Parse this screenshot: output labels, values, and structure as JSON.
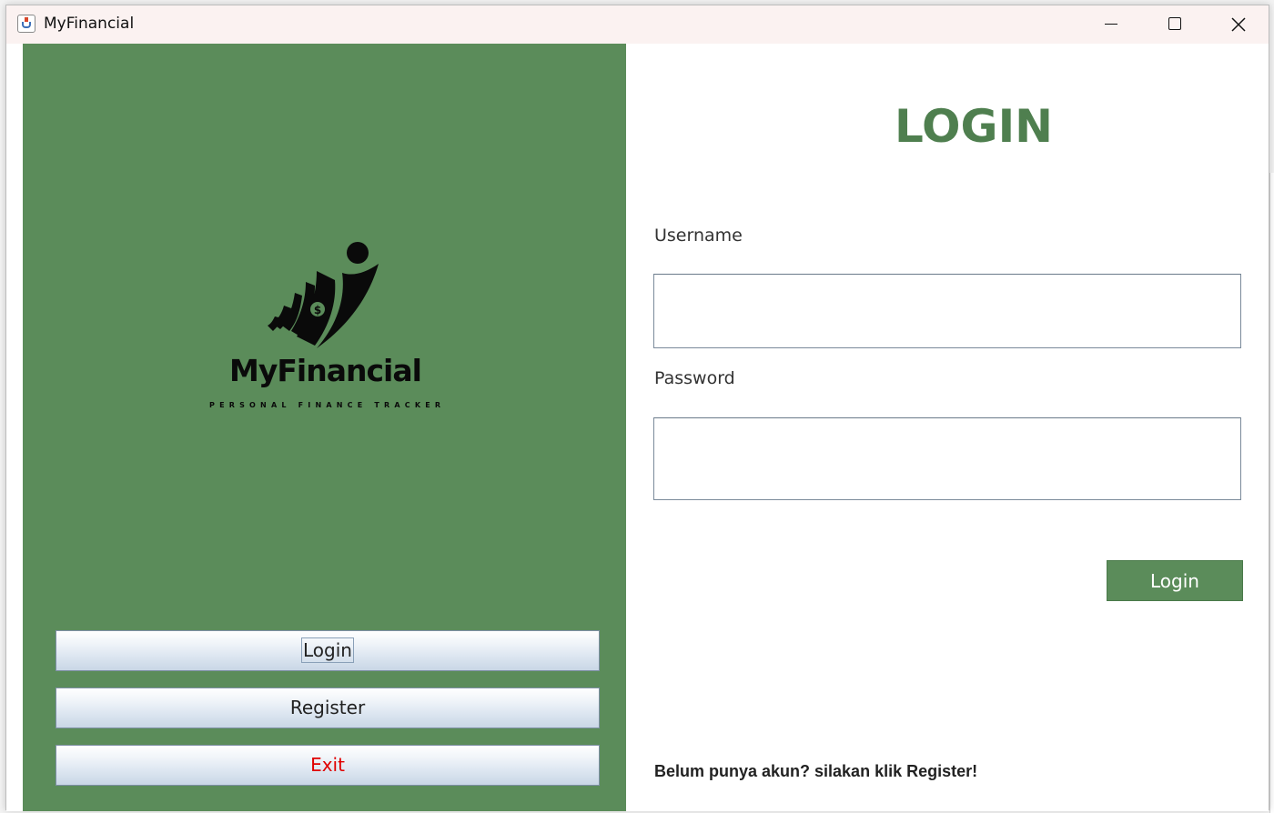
{
  "window": {
    "title": "MyFinancial"
  },
  "left_panel": {
    "logo": {
      "name": "MyFinancial",
      "tagline": "PERSONAL FINANCE TRACKER"
    },
    "buttons": {
      "login": "Login",
      "register": "Register",
      "exit": "Exit"
    }
  },
  "form": {
    "heading": "LOGIN",
    "username_label": "Username",
    "username_value": "",
    "password_label": "Password",
    "password_value": "",
    "submit_label": "Login",
    "register_hint": "Belum punya akun? silakan klik Register!"
  },
  "colors": {
    "panel_green": "#5b8c5a",
    "heading_green": "#4f7f4f",
    "exit_red": "#e00000"
  }
}
